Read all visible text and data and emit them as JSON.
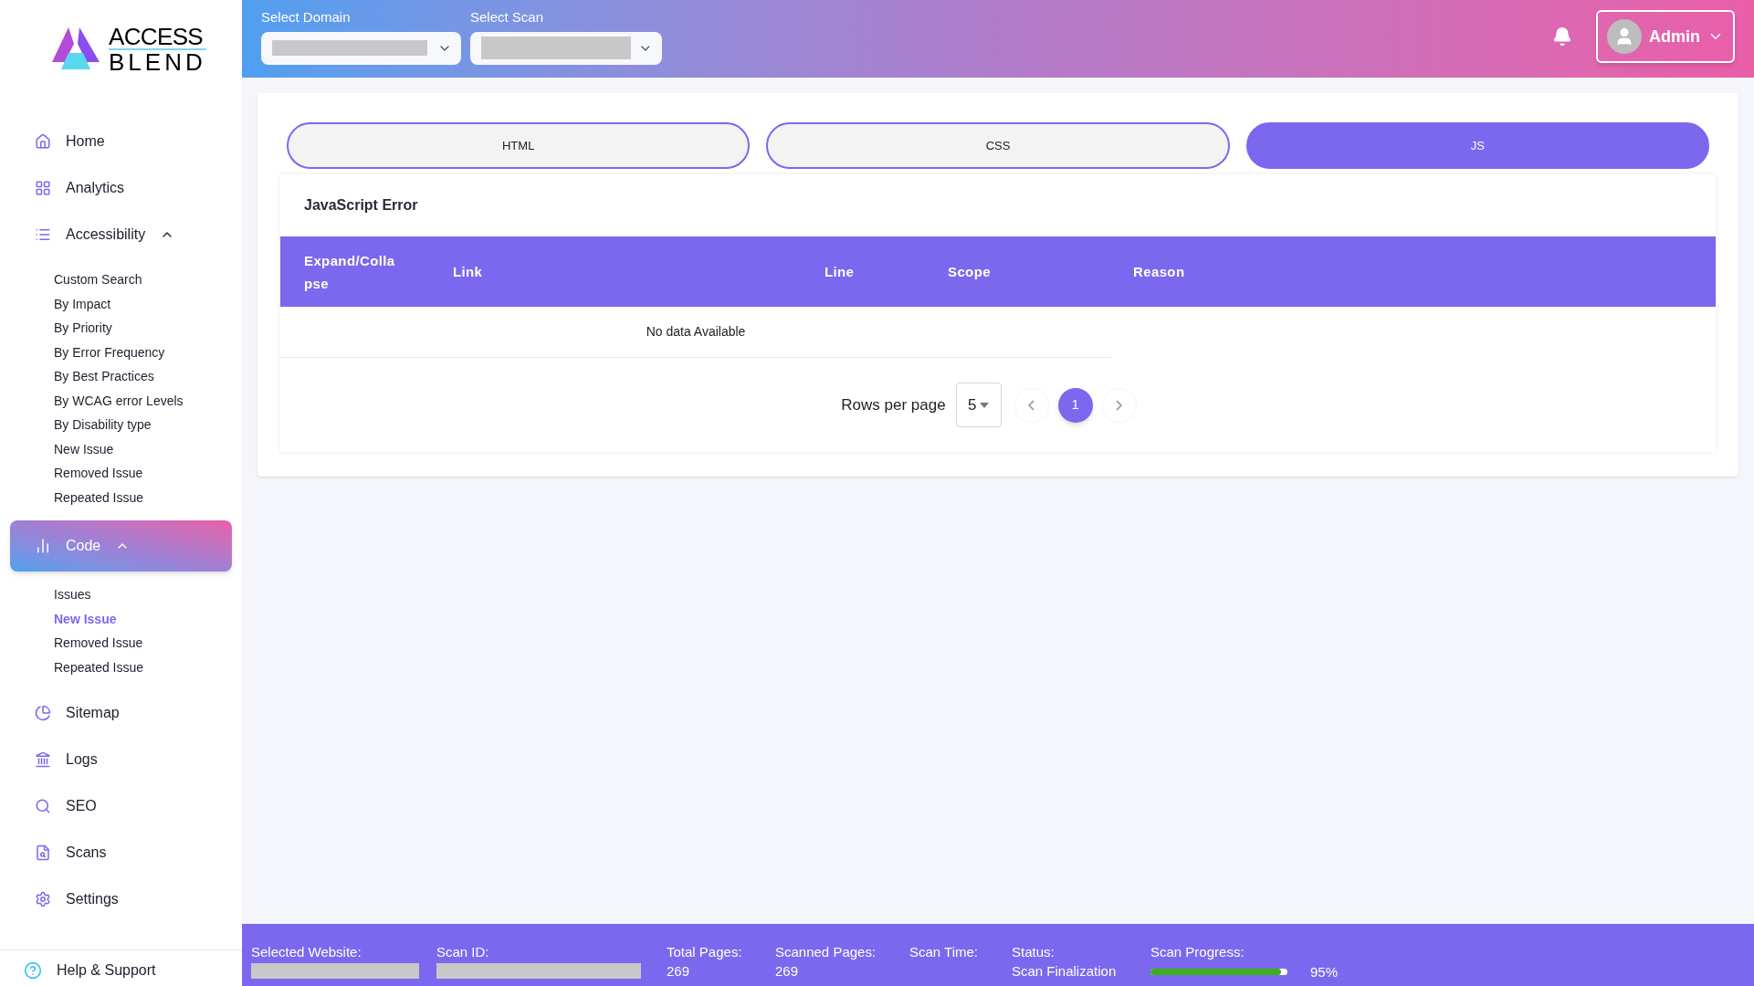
{
  "brand": {
    "line_1": "ACCESS",
    "line_2": "BLEND"
  },
  "sidebar": {
    "items": [
      {
        "label": "Home",
        "kind": "link",
        "selected": false
      },
      {
        "label": "Analytics",
        "kind": "link",
        "selected": false
      },
      {
        "label": "Accessibility",
        "kind": "group",
        "selected": false,
        "expanded": true,
        "children": [
          {
            "label": "Custom Search",
            "selected": false
          },
          {
            "label": "By Impact",
            "selected": false
          },
          {
            "label": "By Priority",
            "selected": false
          },
          {
            "label": "By Error Frequency",
            "selected": false
          },
          {
            "label": "By Best Practices",
            "selected": false
          },
          {
            "label": "By WCAG error Levels",
            "selected": false
          },
          {
            "label": "By Disability type",
            "selected": false
          },
          {
            "label": "New Issue",
            "selected": false
          },
          {
            "label": "Removed Issue",
            "selected": false
          },
          {
            "label": "Repeated Issue",
            "selected": false
          }
        ]
      },
      {
        "label": "Code",
        "kind": "group",
        "selected": true,
        "expanded": true,
        "children": [
          {
            "label": "Issues",
            "selected": false
          },
          {
            "label": "New Issue",
            "selected": true
          },
          {
            "label": "Removed Issue",
            "selected": false
          },
          {
            "label": "Repeated Issue",
            "selected": false
          }
        ]
      },
      {
        "label": "Sitemap",
        "kind": "link",
        "selected": false
      },
      {
        "label": "Logs",
        "kind": "link",
        "selected": false
      },
      {
        "label": "SEO",
        "kind": "link",
        "selected": false
      },
      {
        "label": "Scans",
        "kind": "link",
        "selected": false
      },
      {
        "label": "Settings",
        "kind": "link",
        "selected": false
      }
    ],
    "footer_link": "Help & Support"
  },
  "header": {
    "selects": [
      {
        "label": "Select Domain"
      },
      {
        "label": "Select Scan"
      }
    ],
    "user": "Admin"
  },
  "tabs": [
    {
      "label": "HTML",
      "selected": false
    },
    {
      "label": "CSS",
      "selected": false
    },
    {
      "label": "JS",
      "selected": true
    }
  ],
  "table": {
    "title": "JavaScript Error",
    "columns": [
      "Expand/Colla pse",
      "Link",
      "Line",
      "Scope",
      "Reason"
    ],
    "empty_text": "No data Available"
  },
  "pagination": {
    "rows_per_page_label": "Rows per page",
    "rows_per_page": "5",
    "pages": [
      {
        "label": "1",
        "selected": true
      }
    ]
  },
  "status_bar": {
    "items": [
      {
        "kind": "redacted",
        "label": "Selected Website:"
      },
      {
        "kind": "redacted",
        "label": "Scan ID:"
      },
      {
        "kind": "text",
        "label": "Total Pages:",
        "value": "269"
      },
      {
        "kind": "text",
        "label": "Scanned Pages:",
        "value": "269"
      },
      {
        "kind": "text",
        "label": "Scan Time:"
      },
      {
        "kind": "text",
        "label": "Status:",
        "value": "Scan Finalization"
      },
      {
        "kind": "progress",
        "label": "Scan Progress:",
        "level": 0.95,
        "value": "95%"
      }
    ]
  }
}
